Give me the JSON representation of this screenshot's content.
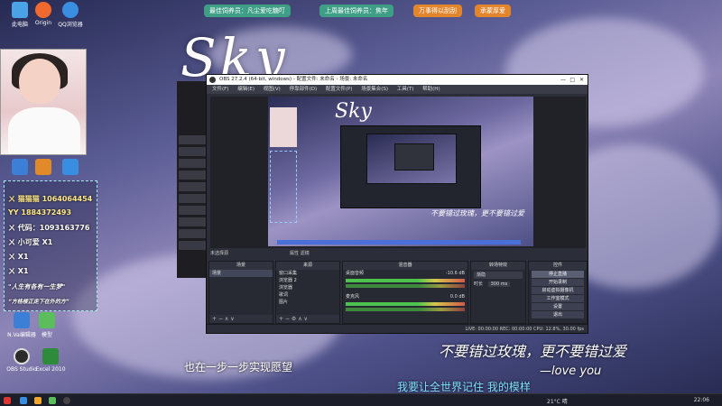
{
  "desktop_icons": [
    {
      "label": "此电脑",
      "color": "#4aa3e6"
    },
    {
      "label": "Origin",
      "color": "#f06a2e"
    },
    {
      "label": "QQ浏览器",
      "color": "#3a8ee0"
    }
  ],
  "banner": {
    "items": [
      "最佳饲养员：凡尘爱吃糖叮",
      "上周最佳饲养员：焦年",
      "万事得以刮刮",
      "承蒙厚爱"
    ]
  },
  "sky_title": "Sky",
  "left_panel": {
    "lines": [
      "ㄨ 猫猫猫 1064064454",
      "YY 1884372493",
      "ㄨ 代码：1093163776",
      "ㄨ 小可爱 X1",
      "ㄨ X1",
      "ㄨ X1",
      "\"人生有各有一生梦\"",
      "“方格楼正走下在外的方”"
    ]
  },
  "side_icons": [
    {
      "label": "N.Va编辑器",
      "color": "#3c7fd6"
    },
    {
      "label": "模型",
      "color": "#5bbd5b"
    },
    {
      "label": "OBS Studio",
      "color": "#2b2b2b"
    },
    {
      "label": "Excel 2010",
      "color": "#2e8b3b"
    }
  ],
  "obs": {
    "title": "OBS 27.2.4 (64-bit, windows) - 配置文件: 未命名 - 场景: 未命名",
    "menu": [
      "文件(F)",
      "编辑(E)",
      "视图(V)",
      "停靠部件(D)",
      "配置文件(P)",
      "场景集合(S)",
      "工具(T)",
      "帮助(H)"
    ],
    "preview_caption": "不要错过玫瑰，更不要错过爱",
    "toolbar_left": "未选择源",
    "toolbar_mid": "属性   滤镜",
    "scenes": {
      "header": "场景",
      "items": [
        "场景"
      ]
    },
    "sources": {
      "header": "来源",
      "items": [
        "窗口采集",
        "浏览器 2",
        "浏览器",
        "歌词",
        "图片"
      ]
    },
    "mixer": {
      "header": "混音器",
      "channels": [
        {
          "name": "桌面音频",
          "db": "-10.6 dB"
        },
        {
          "name": "麦克风",
          "db": "0.0 dB"
        }
      ]
    },
    "transitions": {
      "header": "转场特效",
      "type": "渐隐",
      "duration_label": "时长",
      "duration": "300 ms"
    },
    "controls": {
      "header": "控件",
      "buttons": [
        "停止直播",
        "开始录制",
        "启动虚拟摄像机",
        "工作室模式",
        "设置",
        "退出"
      ]
    },
    "status": "LIVE: 00:00:00  REC: 00:00:00  CPU: 12.8%, 30.00 fps"
  },
  "lyrics": {
    "line1": "也在一步一步实现愿望",
    "line2": "我要让全世界记住 我的模样",
    "right": "不要错过玫瑰，更不要错过爱",
    "signature": "—love you"
  },
  "taskbar": {
    "clock": "22:06",
    "temp": "21°C 晴"
  }
}
